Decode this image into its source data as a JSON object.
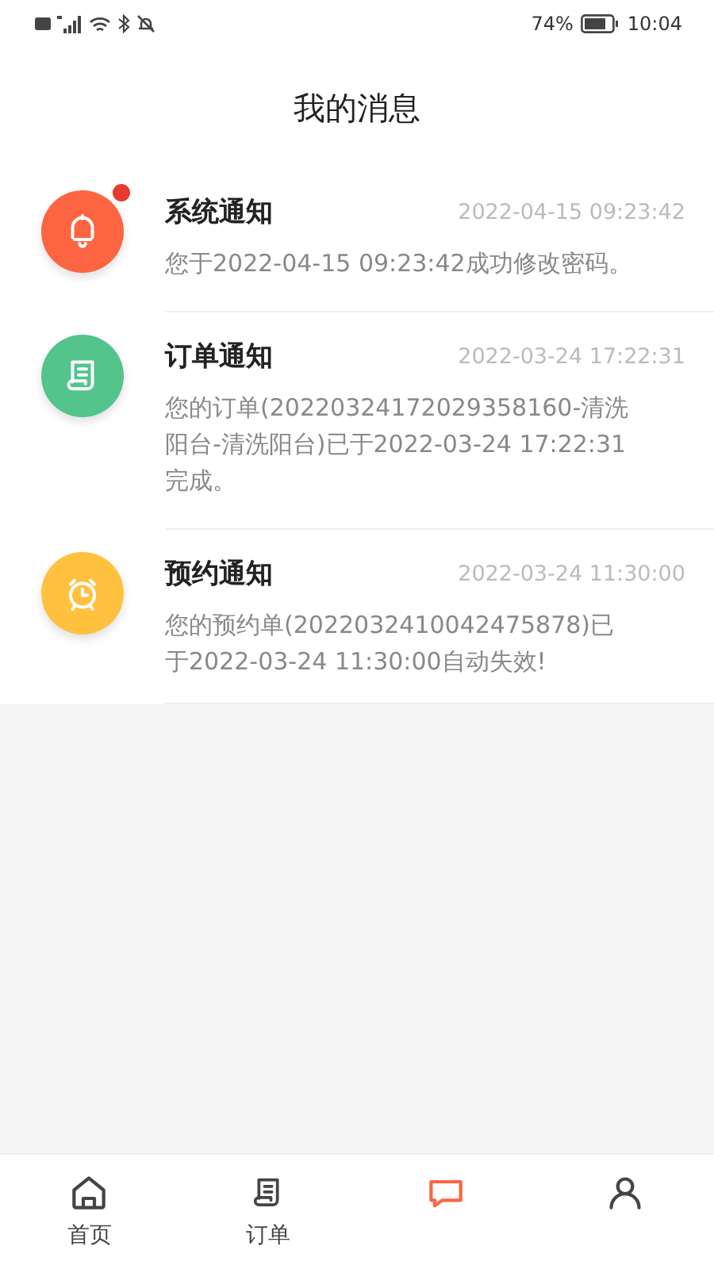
{
  "status_bar": {
    "battery_text": "74%",
    "time": "10:04"
  },
  "header": {
    "title": "我的消息"
  },
  "messages": [
    {
      "kind": "bell",
      "color": "#fd6441",
      "unread": true,
      "title": "系统通知",
      "time": "2022-04-15 09:23:42",
      "body": "您于2022-04-15 09:23:42成功修改密码。"
    },
    {
      "kind": "document",
      "color": "#52c48c",
      "unread": false,
      "title": "订单通知",
      "time": "2022-03-24 17:22:31",
      "body": "您的订单(20220324172029358160-清洗阳台-清洗阳台)已于2022-03-24 17:22:31完成。"
    },
    {
      "kind": "clock",
      "color": "#ffc13e",
      "unread": false,
      "title": "预约通知",
      "time": "2022-03-24 11:30:00",
      "body": "您的预约单(2022032410042475878)已于2022-03-24 11:30:00自动失效!"
    }
  ],
  "tabs": [
    {
      "kind": "home",
      "label": "首页",
      "selected": false
    },
    {
      "kind": "document",
      "label": "订单",
      "selected": false
    },
    {
      "kind": "message",
      "selected": true
    },
    {
      "kind": "person",
      "selected": false
    }
  ]
}
